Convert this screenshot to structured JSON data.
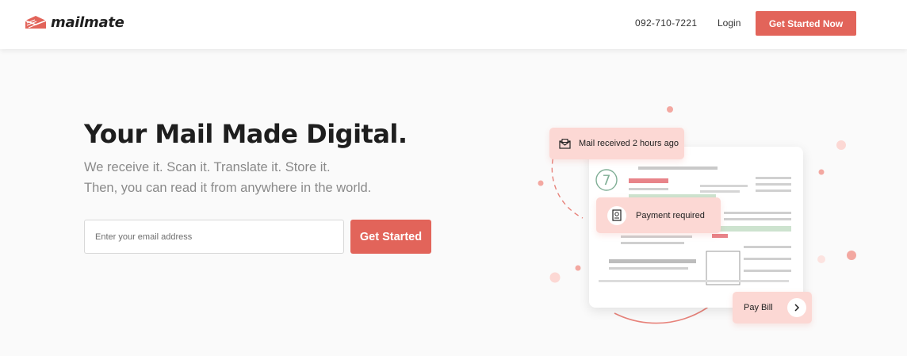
{
  "brand": {
    "name": "mailmate",
    "accent": "#e2645a"
  },
  "header": {
    "phone": "092-710-7221",
    "login_label": "Login",
    "cta_label": "Get Started Now"
  },
  "hero": {
    "title": "Your Mail Made Digital.",
    "subtitle_line1": "We receive it. Scan it. Translate it. Store it.",
    "subtitle_line2": "Then, you can read it from anywhere in the world.",
    "email_placeholder": "Enter your email address",
    "cta_label": "Get Started"
  },
  "illustration": {
    "card_mail": "Mail received 2 hours ago",
    "card_payment": "Payment required",
    "card_bill": "Pay Bill",
    "document_number": "7",
    "icons": [
      "envelope-icon",
      "bill-icon",
      "chevron-right-icon"
    ]
  }
}
